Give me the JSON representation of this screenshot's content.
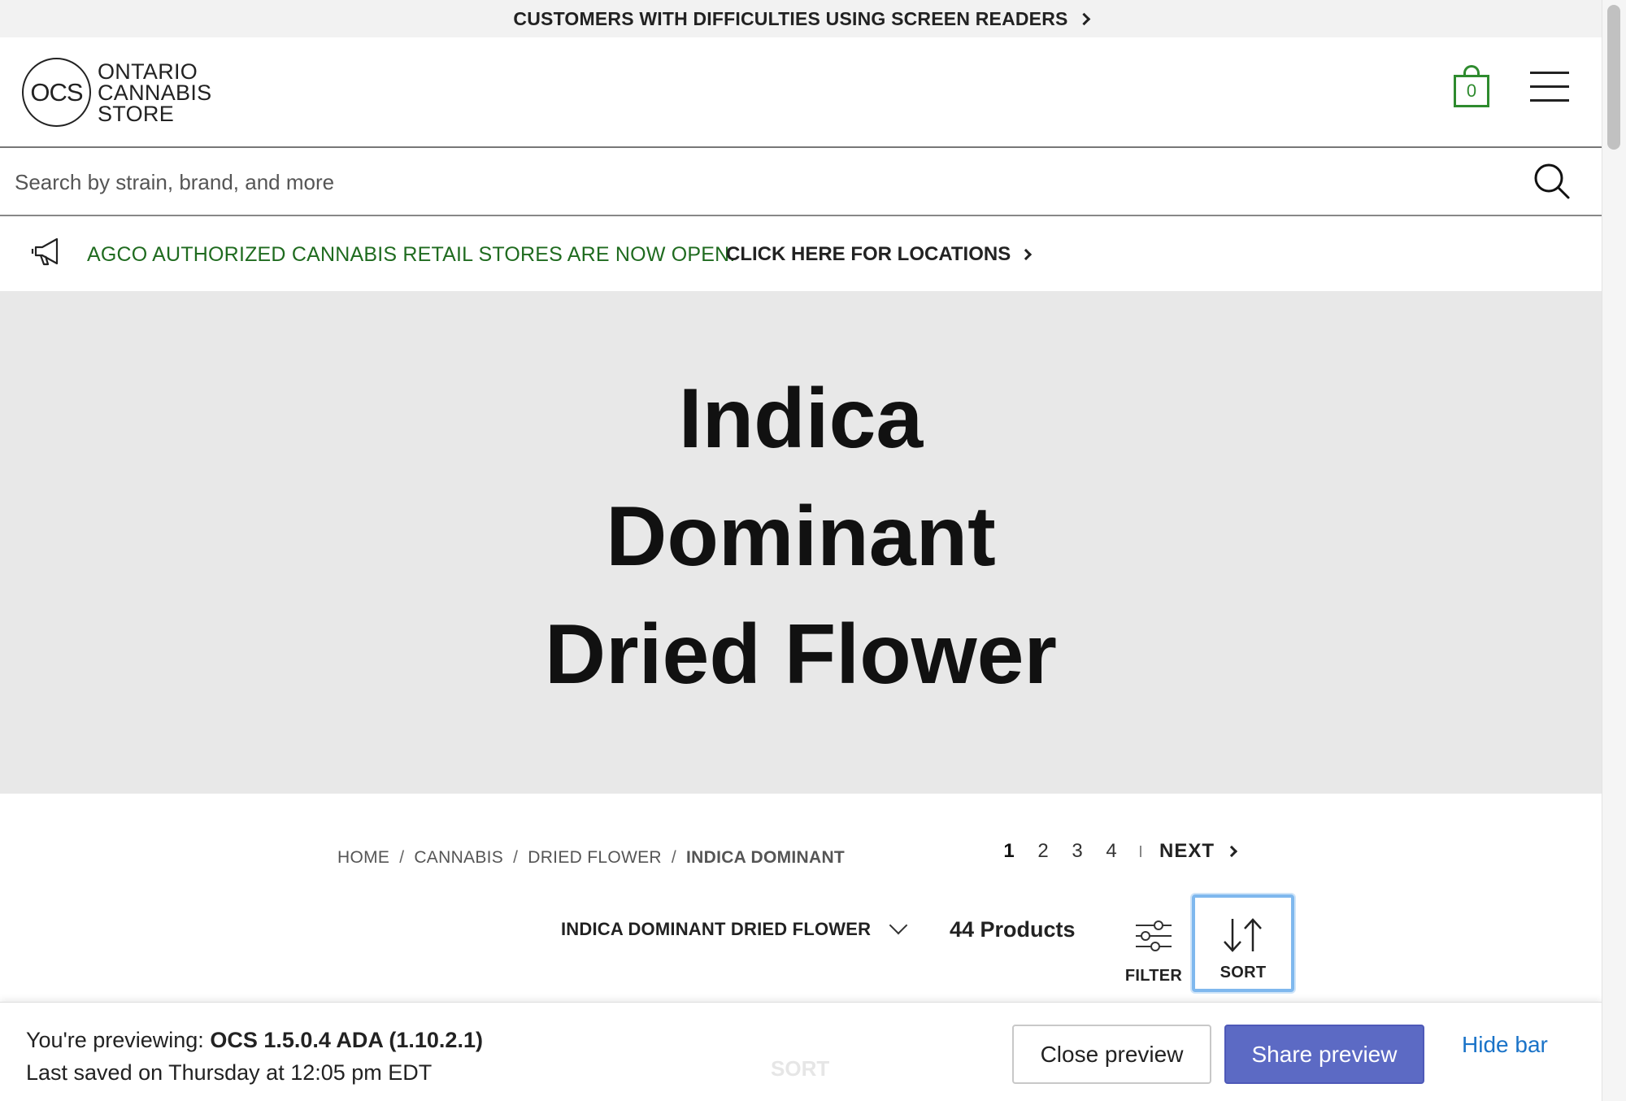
{
  "a11y_bar": {
    "text": "CUSTOMERS WITH DIFFICULTIES USING SCREEN READERS"
  },
  "header": {
    "logo_mark": "OCS",
    "logo_lines": [
      "ONTARIO",
      "CANNABIS",
      "STORE"
    ],
    "cart_count": "0"
  },
  "search": {
    "placeholder": "Search by strain, brand, and more"
  },
  "announcement": {
    "message": "AGCO AUTHORIZED CANNABIS RETAIL STORES ARE NOW OPEN.",
    "link": "CLICK HERE FOR LOCATIONS"
  },
  "hero": {
    "title_lines": [
      "Indica",
      "Dominant",
      "Dried Flower"
    ]
  },
  "breadcrumb": {
    "items": [
      "HOME",
      "CANNABIS",
      "DRIED FLOWER",
      "INDICA DOMINANT"
    ],
    "separator": "/"
  },
  "pagination": {
    "pages": [
      "1",
      "2",
      "3",
      "4"
    ],
    "active": "1",
    "next": "NEXT"
  },
  "toolbar": {
    "category": "INDICA DOMINANT DRIED FLOWER",
    "count": "44 Products",
    "filter_label": "FILTER",
    "sort_label": "SORT"
  },
  "preview_bar": {
    "prefix": "You're previewing:",
    "theme": "OCS 1.5.0.4 ADA (1.10.2.1)",
    "saved": "Last saved on Thursday at 12:05 pm EDT",
    "ghost_sort": "SORT",
    "close": "Close preview",
    "share": "Share preview",
    "hide": "Hide bar"
  },
  "colors": {
    "brand_green": "#2e8b2e",
    "announce_green": "#1f6b1f",
    "share_button": "#5c6ac4",
    "link_blue": "#1a73c8",
    "focus_ring": "#7fb8ee"
  }
}
